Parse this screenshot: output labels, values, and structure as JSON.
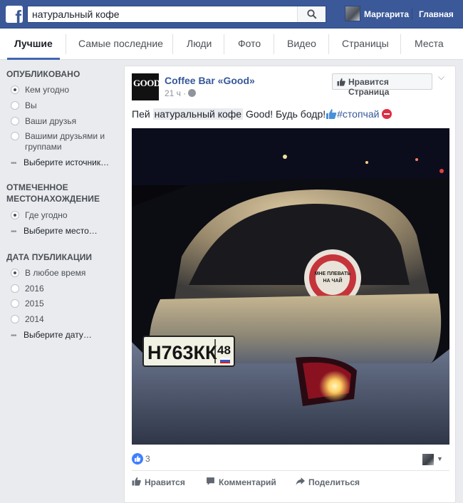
{
  "search": {
    "query": "натуральный кофе"
  },
  "topbar": {
    "user_name": "Маргарита",
    "home_label": "Главная"
  },
  "tabs": [
    "Лучшие",
    "Самые последние",
    "Люди",
    "Фото",
    "Видео",
    "Страницы",
    "Места"
  ],
  "sidebar": {
    "published": {
      "heading": "ОПУБЛИКОВАНО",
      "options": [
        "Кем угодно",
        "Вы",
        "Ваши друзья",
        "Вашими друзьями и группами"
      ],
      "selected_index": 0,
      "more": "Выберите источник…"
    },
    "location": {
      "heading": "ОТМЕЧЕННОЕ МЕСТОНАХОЖДЕНИЕ",
      "options": [
        "Где угодно"
      ],
      "selected_index": 0,
      "more": "Выберите место…"
    },
    "date": {
      "heading": "ДАТА ПУБЛИКАЦИИ",
      "options": [
        "В любое время",
        "2016",
        "2015",
        "2014"
      ],
      "selected_index": 0,
      "more": "Выберите дату…"
    }
  },
  "post": {
    "page_name": "Coffee Bar «Good»",
    "page_logo_text": "GOOD",
    "time": "21 ч ·",
    "like_page_label": "Нравится Страница",
    "text_before": "Пей ",
    "text_highlight": "натуральный кофе",
    "text_after": " Good! Будь бодр!",
    "hashtag": "#стопчай",
    "photo": {
      "plate": "Н763КК",
      "region": "48",
      "sticker_text": "МНЕ ПЛЕВАТЬ НА ЧАЙ"
    },
    "reaction_count": "3",
    "actions": {
      "like": "Нравится",
      "comment": "Комментарий",
      "share": "Поделиться"
    }
  },
  "colors": {
    "brand": "#3b5998",
    "link": "#365899",
    "tab_active": "#4267b2"
  }
}
